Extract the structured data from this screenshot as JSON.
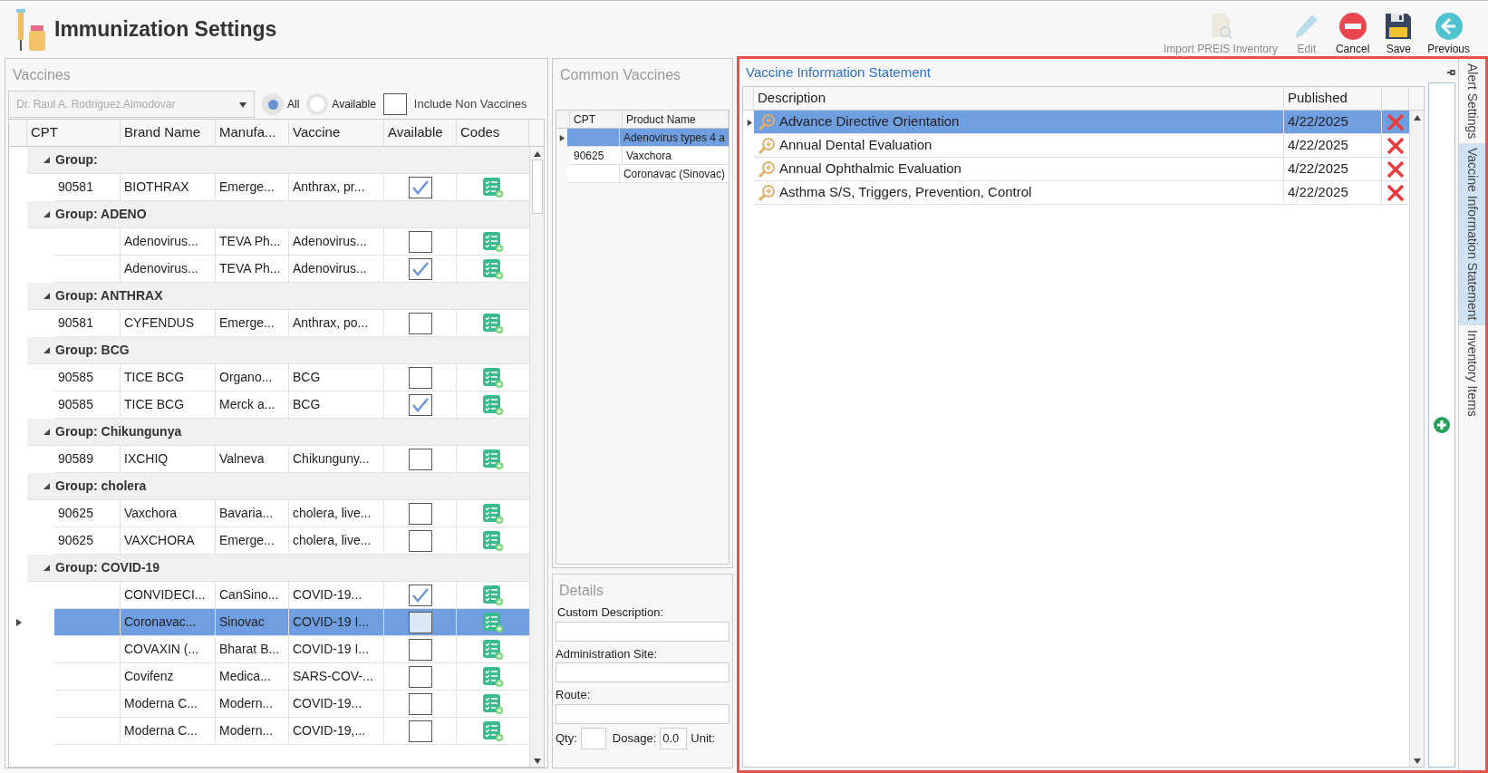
{
  "window": {
    "title": "Immunization Settings"
  },
  "toolbar": [
    {
      "kind": "import",
      "label": "Import PREIS Inventory",
      "disabled": true
    },
    {
      "kind": "edit",
      "label": "Edit",
      "disabled": true
    },
    {
      "kind": "cancel",
      "label": "Cancel",
      "disabled": false
    },
    {
      "kind": "save",
      "label": "Save",
      "disabled": false
    },
    {
      "kind": "previous",
      "label": "Previous",
      "disabled": false
    }
  ],
  "vaccines": {
    "title": "Vaccines",
    "provider": "Dr. Raul A. Rodriguez Almodovar",
    "filters": [
      {
        "label": "All",
        "selected": true
      },
      {
        "label": "Available",
        "selected": false
      }
    ],
    "include_non_vaccines": {
      "label": "Include Non Vaccines",
      "checked": false
    },
    "columns": [
      "CPT",
      "Brand Name",
      "Manufa...",
      "Vaccine",
      "Available",
      "Codes"
    ],
    "rows": [
      {
        "kind": "group",
        "label": "Group:"
      },
      {
        "kind": "item",
        "cpt": "90581",
        "brand": "BIOTHRAX",
        "manufacturer": "Emerge...",
        "vaccine": "Anthrax, pr...",
        "available": true,
        "selected": false
      },
      {
        "kind": "group",
        "label": "Group: ADENO"
      },
      {
        "kind": "item",
        "brand": "Adenovirus...",
        "manufacturer": "TEVA Ph...",
        "vaccine": "Adenovirus...",
        "available": false,
        "selected": false
      },
      {
        "kind": "item",
        "brand": "Adenovirus...",
        "manufacturer": "TEVA Ph...",
        "vaccine": "Adenovirus...",
        "available": true,
        "selected": false
      },
      {
        "kind": "group",
        "label": "Group: ANTHRAX"
      },
      {
        "kind": "item",
        "cpt": "90581",
        "brand": "CYFENDUS",
        "manufacturer": "Emerge...",
        "vaccine": "Anthrax, po...",
        "available": false,
        "selected": false
      },
      {
        "kind": "group",
        "label": "Group: BCG"
      },
      {
        "kind": "item",
        "cpt": "90585",
        "brand": "TICE BCG",
        "manufacturer": "Organo...",
        "vaccine": "BCG",
        "available": false,
        "selected": false
      },
      {
        "kind": "item",
        "cpt": "90585",
        "brand": "TICE BCG",
        "manufacturer": "Merck a...",
        "vaccine": "BCG",
        "available": true,
        "selected": false
      },
      {
        "kind": "group",
        "label": "Group: Chikungunya"
      },
      {
        "kind": "item",
        "cpt": "90589",
        "brand": "IXCHIQ",
        "manufacturer": "Valneva",
        "vaccine": "Chikunguny...",
        "available": false,
        "selected": false
      },
      {
        "kind": "group",
        "label": "Group: cholera"
      },
      {
        "kind": "item",
        "cpt": "90625",
        "brand": "Vaxchora",
        "manufacturer": "Bavaria...",
        "vaccine": "cholera, live...",
        "available": false,
        "selected": false
      },
      {
        "kind": "item",
        "cpt": "90625",
        "brand": "VAXCHORA",
        "manufacturer": "Emerge...",
        "vaccine": "cholera, live...",
        "available": false,
        "selected": false
      },
      {
        "kind": "group",
        "label": "Group: COVID-19"
      },
      {
        "kind": "item",
        "brand": "CONVIDECI...",
        "manufacturer": "CanSino...",
        "vaccine": "COVID-19...",
        "available": true,
        "selected": false
      },
      {
        "kind": "item",
        "brand": "Coronavac...",
        "manufacturer": "Sinovac",
        "vaccine": "COVID-19 I...",
        "available": false,
        "selected": true
      },
      {
        "kind": "item",
        "brand": "COVAXIN (...",
        "manufacturer": "Bharat B...",
        "vaccine": "COVID-19 I...",
        "available": false,
        "selected": false
      },
      {
        "kind": "item",
        "brand": "Covifenz",
        "manufacturer": "Medica...",
        "vaccine": "SARS-COV-...",
        "available": false,
        "selected": false
      },
      {
        "kind": "item",
        "brand": "Moderna C...",
        "manufacturer": "Modern...",
        "vaccine": "COVID-19...",
        "available": false,
        "selected": false
      },
      {
        "kind": "item",
        "brand": "Moderna C...",
        "manufacturer": "Modern...",
        "vaccine": "COVID-19,...",
        "available": false,
        "selected": false
      }
    ]
  },
  "common_vaccines": {
    "title": "Common Vaccines",
    "columns": [
      "CPT",
      "Product Name"
    ],
    "rows": [
      {
        "cpt": "",
        "product": "Adenovirus types 4 a",
        "selected": true
      },
      {
        "cpt": "90625",
        "product": "Vaxchora",
        "selected": false
      },
      {
        "cpt": "",
        "product": "Coronavac (Sinovac)",
        "selected": false
      }
    ]
  },
  "details": {
    "title": "Details",
    "custom_description": "Custom Description:",
    "administration_site": "Administration Site:",
    "route": "Route:",
    "qty": "Qty:",
    "dosage": "Dosage:",
    "dosage_value": "0.0",
    "unit": "Unit:"
  },
  "vis": {
    "title": "Vaccine Information Statement",
    "columns": [
      "Description",
      "Published"
    ],
    "rows": [
      {
        "description": "Advance Directive Orientation",
        "published": "4/22/2025",
        "selected": true
      },
      {
        "description": "Annual Dental Evaluation",
        "published": "4/22/2025",
        "selected": false
      },
      {
        "description": "Annual Ophthalmic Evaluation",
        "published": "4/22/2025",
        "selected": false
      },
      {
        "description": "Asthma S/S, Triggers, Prevention, Control",
        "published": "4/22/2025",
        "selected": false
      }
    ]
  },
  "side_tabs": [
    {
      "label": "Alert Settings",
      "selected": false
    },
    {
      "label": "Vaccine Information Statement",
      "selected": true
    },
    {
      "label": "Inventory Items",
      "selected": false
    }
  ]
}
